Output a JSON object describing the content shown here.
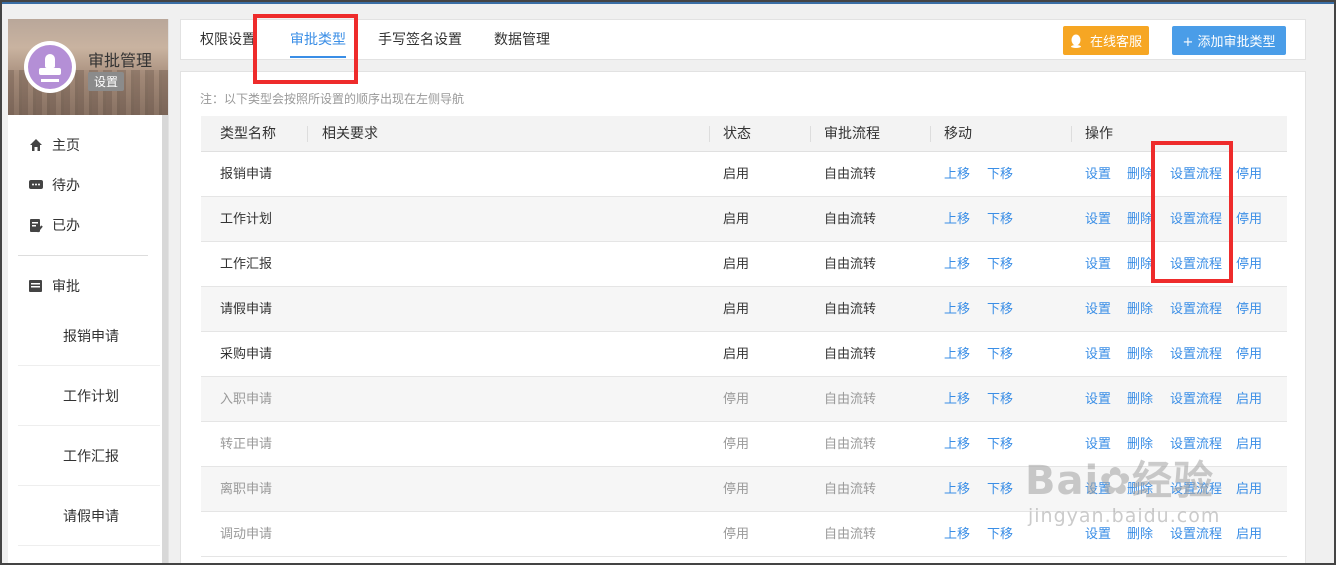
{
  "sidebar": {
    "title": "审批管理",
    "badge": "设置",
    "nav": [
      {
        "label": "主页",
        "icon": "home-icon"
      },
      {
        "label": "待办",
        "icon": "todo-icon"
      },
      {
        "label": "已办",
        "icon": "done-icon"
      }
    ],
    "section": {
      "label": "审批",
      "icon": "approval-icon"
    },
    "sub_items": [
      "报销申请",
      "工作计划",
      "工作汇报",
      "请假申请"
    ]
  },
  "tabs": [
    {
      "label": "权限设置",
      "active": false
    },
    {
      "label": "审批类型",
      "active": true
    },
    {
      "label": "手写签名设置",
      "active": false
    },
    {
      "label": "数据管理",
      "active": false
    }
  ],
  "buttons": {
    "service": "在线客服",
    "add": "+ 添加审批类型"
  },
  "note": "注：以下类型会按照所设置的顺序出现在左侧导航",
  "table": {
    "headers": {
      "name": "类型名称",
      "req": "相关要求",
      "status": "状态",
      "flow": "审批流程",
      "move": "移动",
      "ops": "操作"
    },
    "move_up": "上移",
    "move_down": "下移",
    "op_set": "设置",
    "op_delete": "删除",
    "op_flow": "设置流程",
    "rows": [
      {
        "name": "报销申请",
        "status": "启用",
        "flow": "自由流转",
        "toggle": "停用",
        "enabled": true
      },
      {
        "name": "工作计划",
        "status": "启用",
        "flow": "自由流转",
        "toggle": "停用",
        "enabled": true
      },
      {
        "name": "工作汇报",
        "status": "启用",
        "flow": "自由流转",
        "toggle": "停用",
        "enabled": true
      },
      {
        "name": "请假申请",
        "status": "启用",
        "flow": "自由流转",
        "toggle": "停用",
        "enabled": true
      },
      {
        "name": "采购申请",
        "status": "启用",
        "flow": "自由流转",
        "toggle": "停用",
        "enabled": true
      },
      {
        "name": "入职申请",
        "status": "停用",
        "flow": "自由流转",
        "toggle": "启用",
        "enabled": false
      },
      {
        "name": "转正申请",
        "status": "停用",
        "flow": "自由流转",
        "toggle": "启用",
        "enabled": false
      },
      {
        "name": "离职申请",
        "status": "停用",
        "flow": "自由流转",
        "toggle": "启用",
        "enabled": false
      },
      {
        "name": "调动申请",
        "status": "停用",
        "flow": "自由流转",
        "toggle": "启用",
        "enabled": false
      }
    ]
  },
  "watermark": {
    "brand": "Bai",
    "brand_suffix": "经验",
    "url": "jingyan.baidu.com"
  },
  "colors": {
    "accent": "#3a8ee6",
    "orange": "#f6a623",
    "highlight": "#ee2b2b"
  }
}
